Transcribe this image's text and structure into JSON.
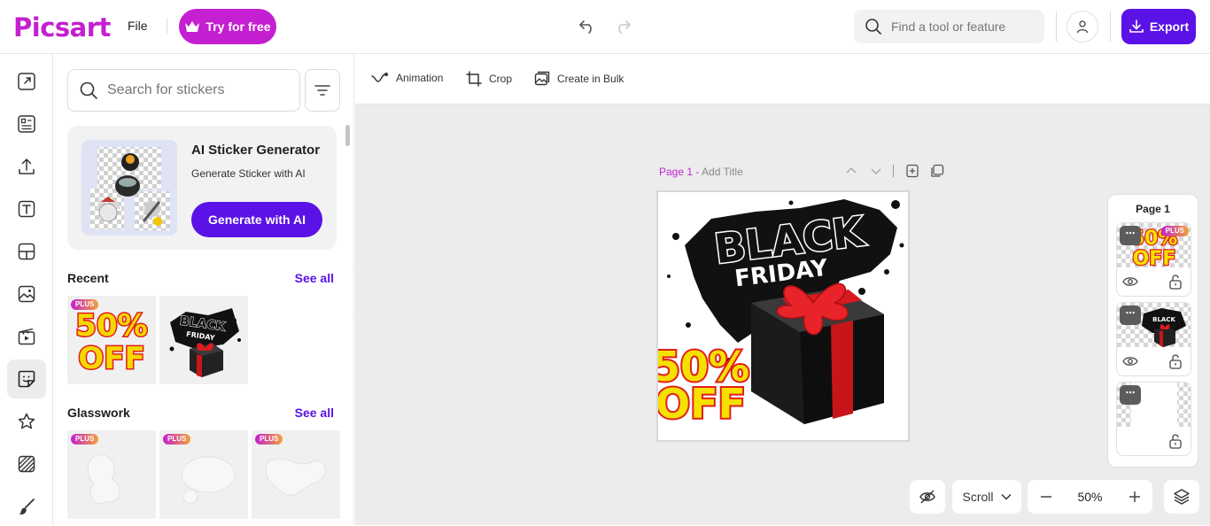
{
  "header": {
    "logo": "Picsart",
    "file_label": "File",
    "try_label": "Try for free",
    "search_placeholder": "Find a tool or feature",
    "export_label": "Export"
  },
  "rail": {
    "items": [
      "resize-icon",
      "templates-icon",
      "upload-icon",
      "text-icon",
      "layout-icon",
      "photos-icon",
      "video-icon",
      "stickers-icon",
      "favorites-icon",
      "background-icon",
      "draw-icon"
    ],
    "active": "stickers-icon"
  },
  "panel": {
    "search_placeholder": "Search for stickers",
    "ai_card": {
      "title": "AI Sticker Generator",
      "subtitle": "Generate Sticker with AI",
      "button": "Generate with AI"
    },
    "recent": {
      "title": "Recent",
      "see_all": "See all",
      "plus_badge": "PLUS"
    },
    "glasswork": {
      "title": "Glasswork",
      "see_all": "See all",
      "plus_badge": "PLUS"
    }
  },
  "toolbar": {
    "animation": "Animation",
    "crop": "Crop",
    "bulk": "Create in Bulk"
  },
  "canvas": {
    "page_label": "Page 1 - ",
    "title_placeholder": "Add Title",
    "black": "BLACK",
    "friday": "FRIDAY",
    "sale_top": "50%",
    "sale_bottom": "OFF"
  },
  "layers": {
    "title": "Page 1",
    "more": "⋯",
    "plus_badge": "PLUS"
  },
  "bottom": {
    "scroll_label": "Scroll",
    "zoom": "50%"
  },
  "colors": {
    "brand_pink": "#c41fd0",
    "brand_purple": "#5a12e6"
  }
}
